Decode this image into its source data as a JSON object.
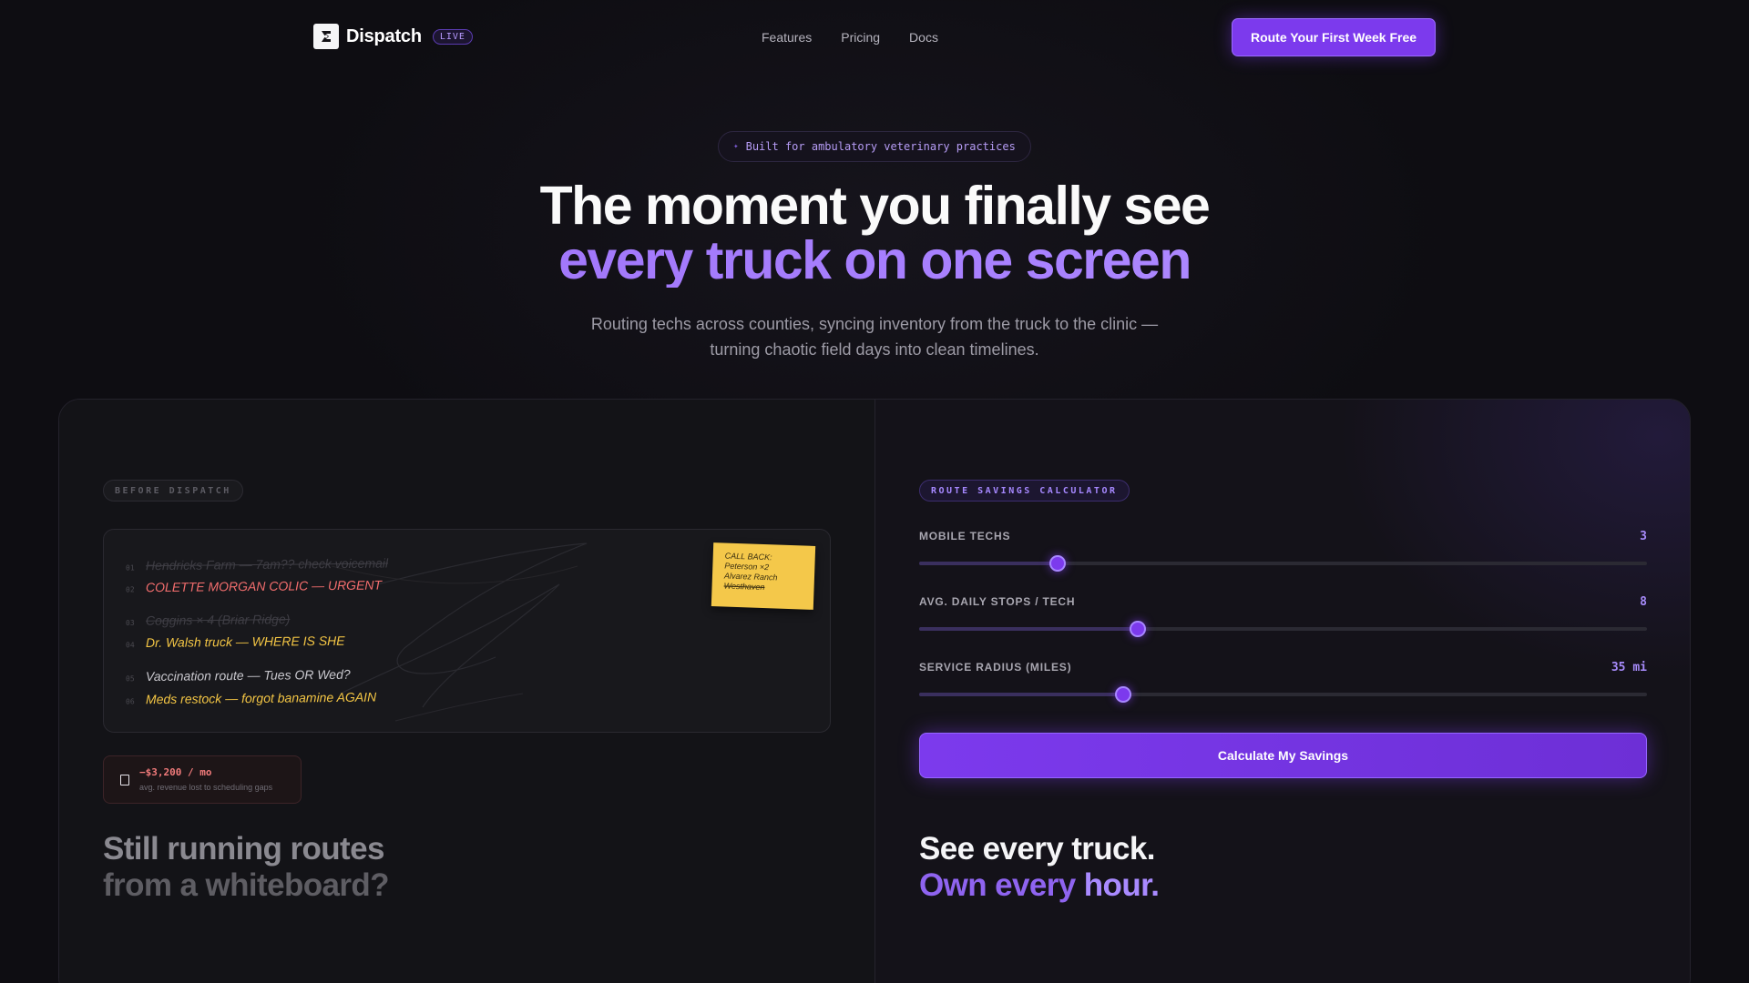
{
  "nav": {
    "brand": "Dispatch",
    "live_badge": "LIVE",
    "links": [
      "Features",
      "Pricing",
      "Docs"
    ],
    "cta": "Route Your First Week Free"
  },
  "hero": {
    "pill": "Built for ambulatory veterinary practices",
    "title_line1": "The moment you finally see",
    "title_line2": "every truck on one screen",
    "subtitle": "Routing techs across counties, syncing inventory from the truck to the clinic — turning chaotic field days into clean timelines."
  },
  "before": {
    "tag": "BEFORE DISPATCH",
    "whiteboard": [
      {
        "num": "01",
        "text": "Hendricks Farm — 7am?? check voicemail",
        "style": "strike"
      },
      {
        "num": "02",
        "text": "COLETTE MORGAN COLIC — URGENT",
        "style": "red"
      },
      {
        "num": "03",
        "text": "Coggins × 4 (Briar Ridge)",
        "style": "strike"
      },
      {
        "num": "04",
        "text": "Dr. Walsh truck — WHERE IS SHE",
        "style": "yellow"
      },
      {
        "num": "05",
        "text": "Vaccination route — Tues OR Wed?",
        "style": "white"
      },
      {
        "num": "06",
        "text": "Meds restock — forgot banamine AGAIN",
        "style": "yellow"
      }
    ],
    "sticky": {
      "line1": "CALL BACK:",
      "line2": "Peterson ×2",
      "line3": "Alvarez Ranch",
      "line4": "Westhaven"
    },
    "loss_value": "−$3,200 / mo",
    "loss_caption": "avg. revenue lost to scheduling gaps",
    "heading_line1": "Still running routes",
    "heading_line2": "from a whiteboard?"
  },
  "calculator": {
    "tag": "ROUTE SAVINGS CALCULATOR",
    "sliders": [
      {
        "label": "MOBILE TECHS",
        "value": "3",
        "fraction": 0.19
      },
      {
        "label": "AVG. DAILY STOPS / TECH",
        "value": "8",
        "fraction": 0.3
      },
      {
        "label": "SERVICE RADIUS (MILES)",
        "value": "35 mi",
        "fraction": 0.28
      }
    ],
    "button": "Calculate My Savings",
    "heading_line1": "See every truck.",
    "heading_line2_a": "Own every ",
    "heading_line2_b": "hour."
  },
  "colors": {
    "accent": "#7c3aed",
    "accent_light": "#a78bfa",
    "urgent": "#f26d6d",
    "warning": "#f3c544",
    "sticky": "#f4c84a"
  },
  "icons": {
    "logo": "dispatch-logo-icon",
    "pill": "sparkle-icon",
    "loss": "receipt-icon"
  }
}
